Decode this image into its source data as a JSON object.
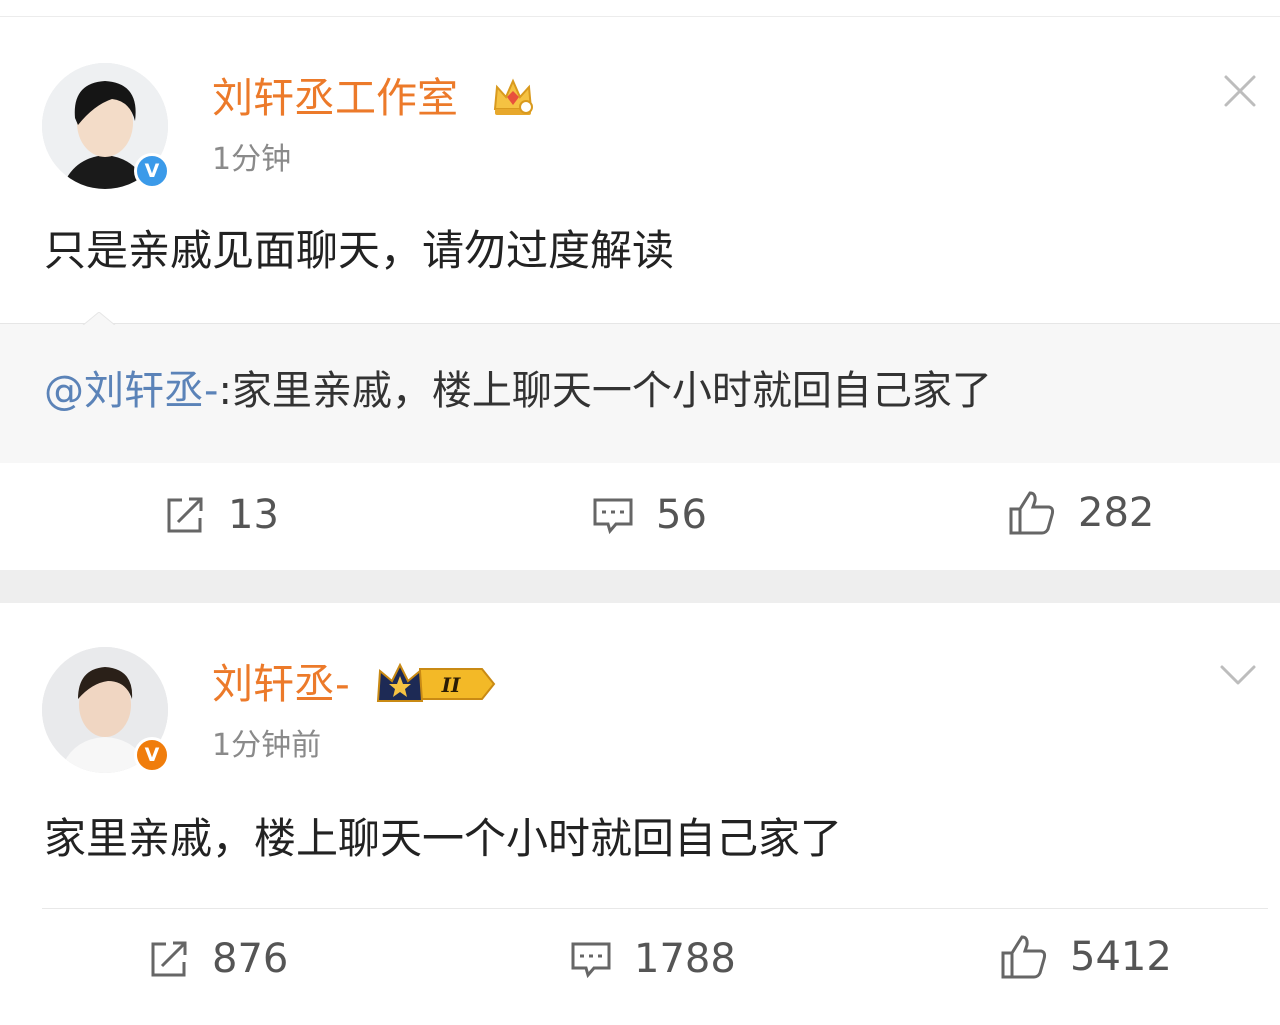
{
  "post1": {
    "username": "刘轩丞工作室",
    "timestamp": "1分钟",
    "content": "只是亲戚见面聊天，请勿过度解读",
    "verified_badge": "V",
    "quote": {
      "mention": "@刘轩丞-",
      "text": ":家里亲戚，楼上聊天一个小时就回自己家了"
    },
    "actions": {
      "repost_count": "13",
      "comment_count": "56",
      "like_count": "282"
    }
  },
  "post2": {
    "username": "刘轩丞-",
    "level_badge": "II",
    "timestamp": "1分钟前",
    "content": "家里亲戚，楼上聊天一个小时就回自己家了",
    "verified_badge": "V",
    "actions": {
      "repost_count": "876",
      "comment_count": "1788",
      "like_count": "5412"
    }
  },
  "colors": {
    "username": "#ec7a2a",
    "mention": "#5b83b8",
    "verified_blue": "#3b9ae9",
    "verified_orange": "#f07d0c",
    "separator": "#eeeeee"
  },
  "icons": [
    "avatar",
    "crown-icon",
    "verified-icon",
    "close-icon",
    "chevron-down-icon",
    "repost-icon",
    "comment-icon",
    "like-icon",
    "level-badge-icon"
  ]
}
